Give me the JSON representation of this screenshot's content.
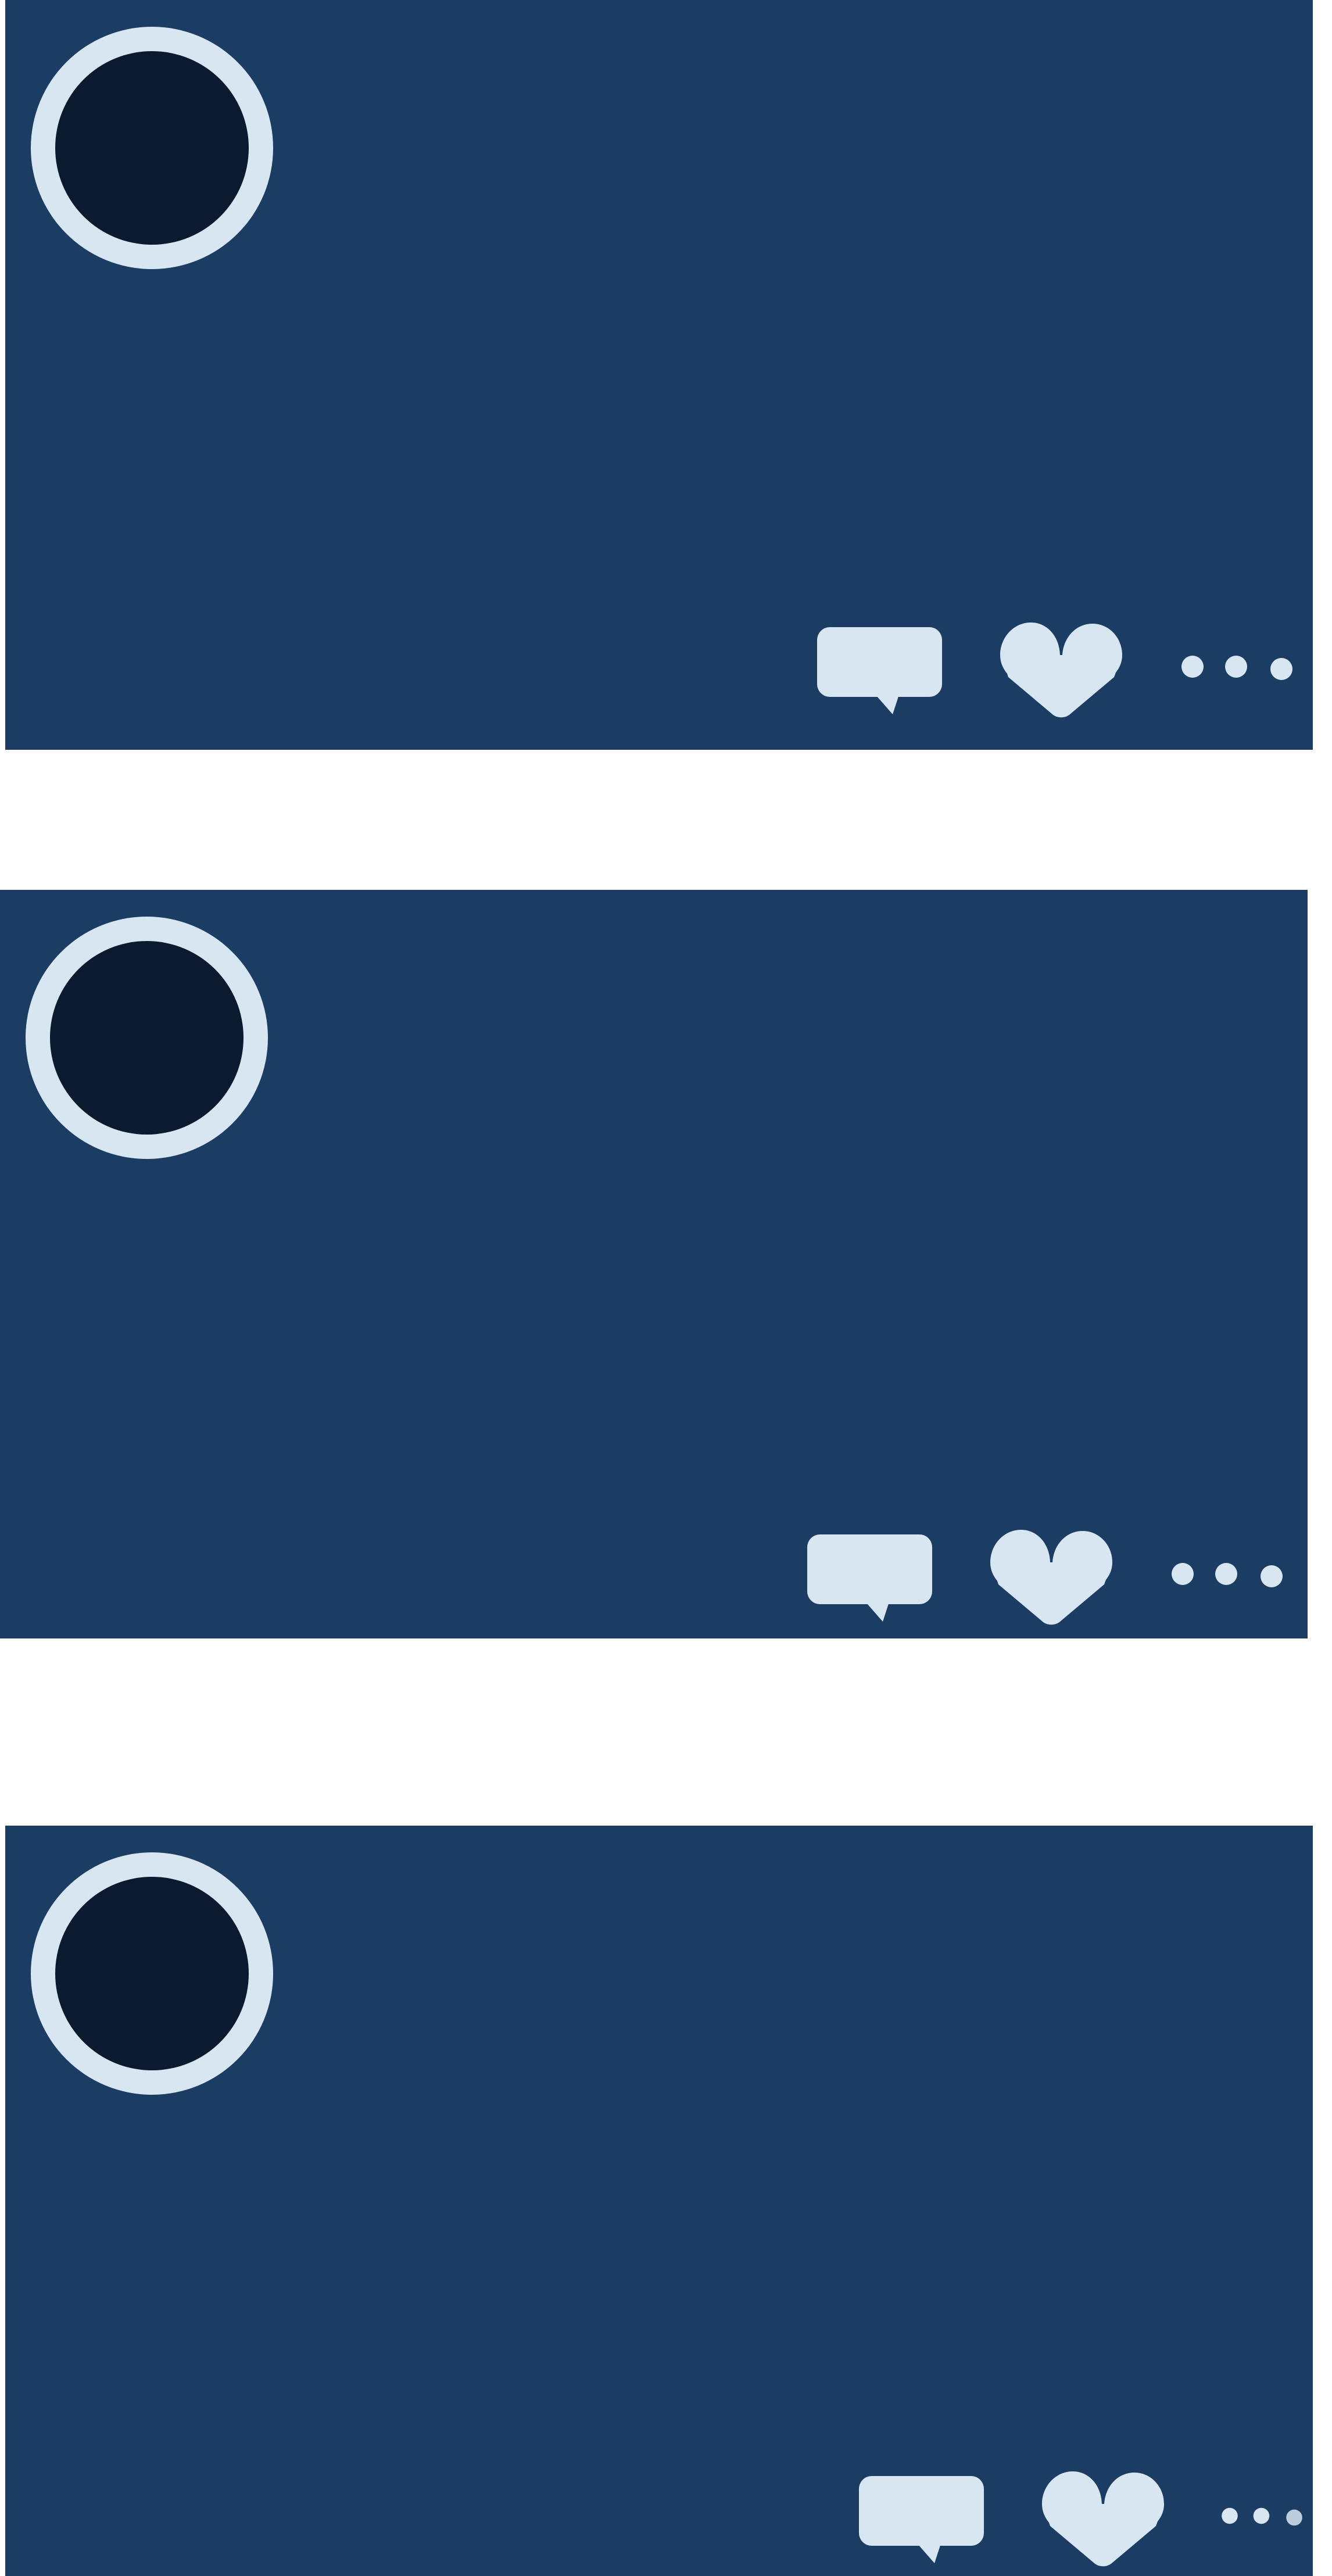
{
  "colors": {
    "card_background": "#1c3d63",
    "avatar_ring": "#d8e6f2",
    "avatar_fill": "#0b1a2e",
    "icon_color": "#d8e6f2",
    "page_background": "#ffffff"
  },
  "cards": [
    {
      "avatar": "avatar-placeholder",
      "actions": [
        "comment-icon",
        "heart-icon",
        "more-options-icon"
      ]
    },
    {
      "avatar": "avatar-placeholder",
      "actions": [
        "comment-icon",
        "heart-icon",
        "more-options-icon"
      ]
    },
    {
      "avatar": "avatar-placeholder",
      "actions": [
        "comment-icon",
        "heart-icon",
        "more-options-icon"
      ]
    }
  ]
}
